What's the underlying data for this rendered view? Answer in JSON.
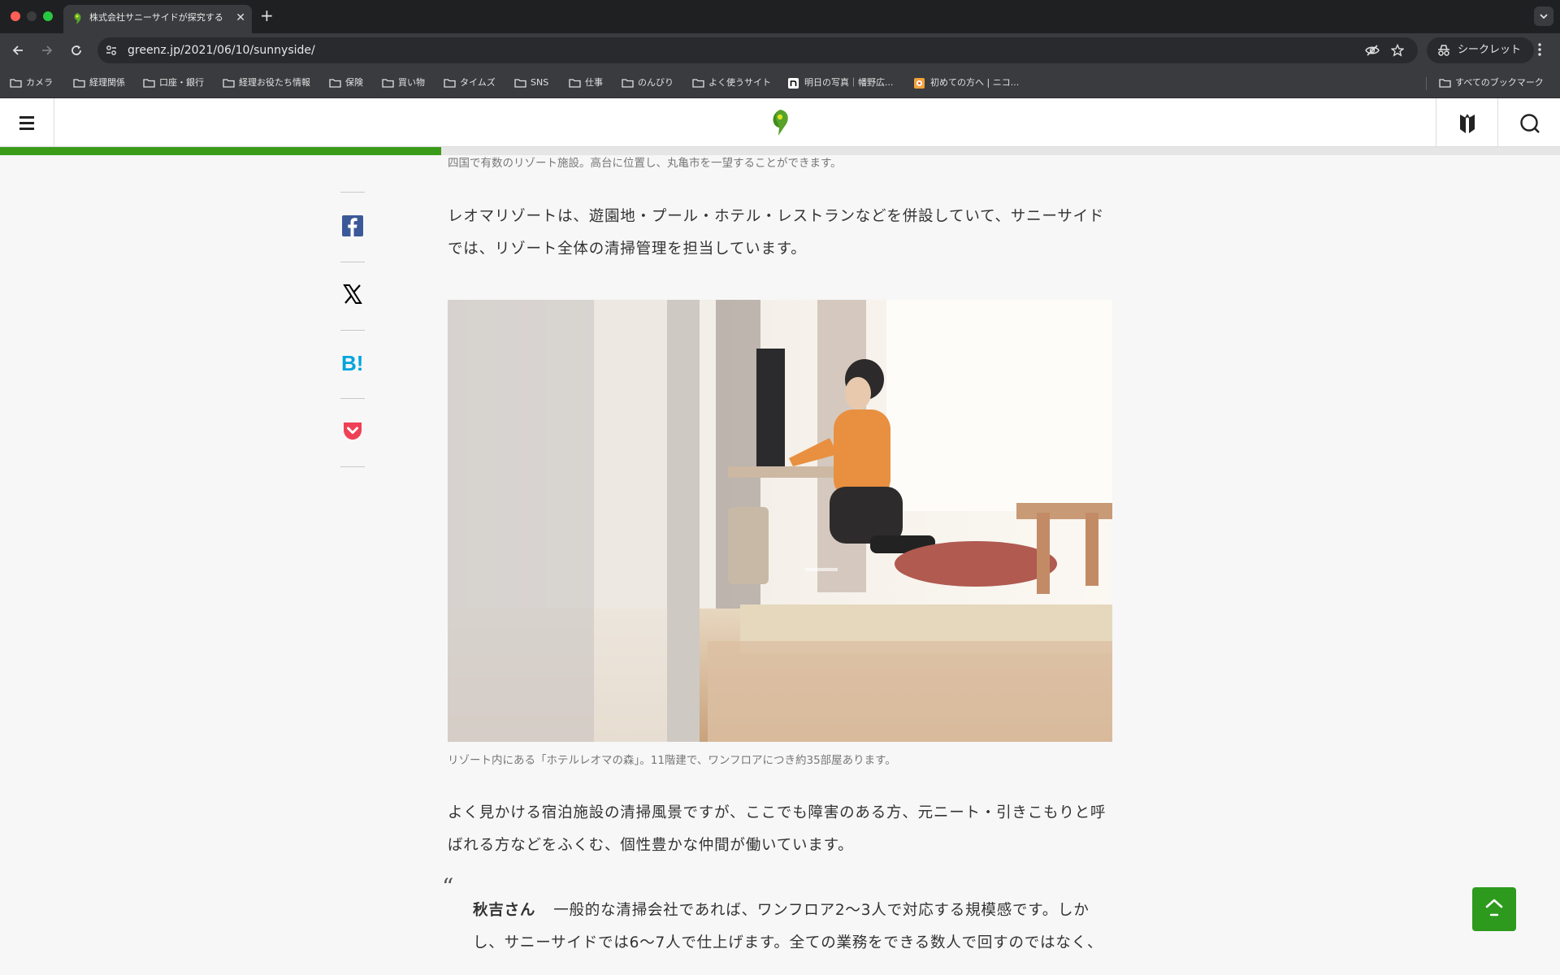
{
  "browser": {
    "tab": {
      "title": "株式会社サニーサイドが探究する",
      "favicon": "greenz-leaf-icon"
    },
    "new_tab": "+",
    "url": "greenz.jp/2021/06/10/sunnyside/",
    "incognito_label": "シークレット",
    "bookmarks": [
      {
        "label": "カメラ",
        "icon": "folder-icon"
      },
      {
        "label": "経理関係",
        "icon": "folder-icon"
      },
      {
        "label": "口座・銀行",
        "icon": "folder-icon"
      },
      {
        "label": "経理お役たち情報",
        "icon": "folder-icon"
      },
      {
        "label": "保険",
        "icon": "folder-icon"
      },
      {
        "label": "買い物",
        "icon": "folder-icon"
      },
      {
        "label": "タイムズ",
        "icon": "folder-icon"
      },
      {
        "label": "SNS",
        "icon": "folder-icon"
      },
      {
        "label": "仕事",
        "icon": "folder-icon"
      },
      {
        "label": "のんびり",
        "icon": "folder-icon"
      },
      {
        "label": "よく使うサイト",
        "icon": "folder-icon"
      },
      {
        "label": "明日の写真｜幡野広...",
        "icon": "note-icon"
      },
      {
        "label": "初めての方へ | ニコ...",
        "icon": "site-icon"
      }
    ],
    "all_bookmarks": "すべてのブックマーク"
  },
  "site": {
    "logo": "greenz-leaf-logo",
    "reading_progress": 0.283,
    "accent_color": "#3a9b19"
  },
  "share": [
    {
      "name": "facebook-share-button",
      "icon": "facebook-icon",
      "color": "#3b5998"
    },
    {
      "name": "x-share-button",
      "icon": "x-icon",
      "color": "#000000"
    },
    {
      "name": "hatena-share-button",
      "icon": "hatena-bookmark-icon",
      "color": "#00a4de"
    },
    {
      "name": "pocket-share-button",
      "icon": "pocket-icon",
      "color": "#ef4056"
    }
  ],
  "article": {
    "caption_top": "四国で有数のリゾート施設。高台に位置し、丸亀市を一望することができます。",
    "para1": "レオマリゾートは、遊園地・プール・ホテル・レストランなどを併設していて、サニーサイドでは、リゾート全体の清掃管理を担当しています。",
    "photo_caption": "リゾート内にある「ホテルレオマの森」。11階建で、ワンフロアにつき約35部屋あります。",
    "para2": "よく見かける宿泊施設の清掃風景ですが、ここでも障害のある方、元ニート・引きこもりと呼ばれる方などをふくむ、個性豊かな仲間が働いています。",
    "quote": {
      "mark": "“",
      "speaker": "秋吉さん",
      "text": "一般的な清掃会社であれば、ワンフロア2〜3人で対応する規模感です。しかし、サニーサイドでは6〜7人で仕上げます。全ての業務をできる数人で回すのではなく、"
    }
  }
}
